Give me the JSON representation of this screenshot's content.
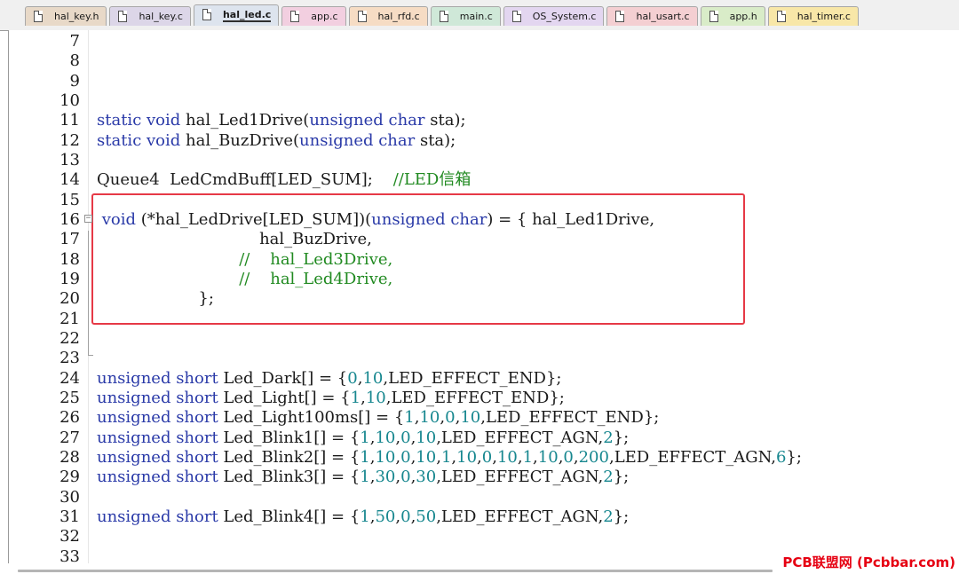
{
  "tabs": [
    {
      "label": "hal_key.h",
      "color": "#e8d9c8",
      "active": false
    },
    {
      "label": "hal_key.c",
      "color": "#dcd6e8",
      "active": false
    },
    {
      "label": "hal_led.c",
      "color": "#dde4ee",
      "active": true
    },
    {
      "label": "app.c",
      "color": "#f2cfe0",
      "active": false
    },
    {
      "label": "hal_rfd.c",
      "color": "#f6dcc4",
      "active": false
    },
    {
      "label": "main.c",
      "color": "#cfe8d8",
      "active": false
    },
    {
      "label": "OS_System.c",
      "color": "#e3d6f0",
      "active": false
    },
    {
      "label": "hal_usart.c",
      "color": "#f4cfd2",
      "active": false
    },
    {
      "label": "app.h",
      "color": "#d9ecc8",
      "active": false
    },
    {
      "label": "hal_timer.c",
      "color": "#f8e7a8",
      "active": false
    }
  ],
  "lines": [
    {
      "n": "7",
      "code": []
    },
    {
      "n": "8",
      "code": []
    },
    {
      "n": "9",
      "code": []
    },
    {
      "n": "10",
      "code": []
    },
    {
      "n": "11",
      "code": [
        [
          "kw",
          "static void"
        ],
        [
          "txt",
          " hal_Led1Drive("
        ],
        [
          "kw",
          "unsigned char"
        ],
        [
          "txt",
          " sta);"
        ]
      ]
    },
    {
      "n": "12",
      "code": [
        [
          "kw",
          "static void"
        ],
        [
          "txt",
          " hal_BuzDrive("
        ],
        [
          "kw",
          "unsigned char"
        ],
        [
          "txt",
          " sta);"
        ]
      ]
    },
    {
      "n": "13",
      "code": []
    },
    {
      "n": "14",
      "code": [
        [
          "txt",
          "Queue4  LedCmdBuff[LED_SUM];    "
        ],
        [
          "cm",
          "//LED信箱"
        ]
      ]
    },
    {
      "n": "15",
      "code": []
    },
    {
      "n": "16",
      "code": [
        [
          "txt",
          " "
        ],
        [
          "kw",
          "void"
        ],
        [
          "txt",
          " (*hal_LedDrive[LED_SUM])("
        ],
        [
          "kw",
          "unsigned char"
        ],
        [
          "txt",
          ") = { hal_Led1Drive,"
        ]
      ],
      "fold": true
    },
    {
      "n": "17",
      "code": [
        [
          "txt",
          "                                hal_BuzDrive,"
        ]
      ]
    },
    {
      "n": "18",
      "code": [
        [
          "cm",
          "                            //    hal_Led3Drive,"
        ]
      ]
    },
    {
      "n": "19",
      "code": [
        [
          "cm",
          "                            //    hal_Led4Drive,"
        ]
      ]
    },
    {
      "n": "20",
      "code": [
        [
          "txt",
          "                    };"
        ]
      ]
    },
    {
      "n": "21",
      "code": []
    },
    {
      "n": "22",
      "code": []
    },
    {
      "n": "23",
      "code": []
    },
    {
      "n": "24",
      "code": [
        [
          "kw",
          "unsigned short"
        ],
        [
          "txt",
          " Led_Dark[] = {"
        ],
        [
          "num",
          "0"
        ],
        [
          "txt",
          ","
        ],
        [
          "num",
          "10"
        ],
        [
          "txt",
          ",LED_EFFECT_END};"
        ]
      ]
    },
    {
      "n": "25",
      "code": [
        [
          "kw",
          "unsigned short"
        ],
        [
          "txt",
          " Led_Light[] = {"
        ],
        [
          "num",
          "1"
        ],
        [
          "txt",
          ","
        ],
        [
          "num",
          "10"
        ],
        [
          "txt",
          ",LED_EFFECT_END};"
        ]
      ]
    },
    {
      "n": "26",
      "code": [
        [
          "kw",
          "unsigned short"
        ],
        [
          "txt",
          " Led_Light100ms[] = {"
        ],
        [
          "num",
          "1"
        ],
        [
          "txt",
          ","
        ],
        [
          "num",
          "10"
        ],
        [
          "txt",
          ","
        ],
        [
          "num",
          "0"
        ],
        [
          "txt",
          ","
        ],
        [
          "num",
          "10"
        ],
        [
          "txt",
          ",LED_EFFECT_END};"
        ]
      ]
    },
    {
      "n": "27",
      "code": [
        [
          "kw",
          "unsigned short"
        ],
        [
          "txt",
          " Led_Blink1[] = {"
        ],
        [
          "num",
          "1"
        ],
        [
          "txt",
          ","
        ],
        [
          "num",
          "10"
        ],
        [
          "txt",
          ","
        ],
        [
          "num",
          "0"
        ],
        [
          "txt",
          ","
        ],
        [
          "num",
          "10"
        ],
        [
          "txt",
          ",LED_EFFECT_AGN,"
        ],
        [
          "num",
          "2"
        ],
        [
          "txt",
          "};"
        ]
      ]
    },
    {
      "n": "28",
      "code": [
        [
          "kw",
          "unsigned short"
        ],
        [
          "txt",
          " Led_Blink2[] = {"
        ],
        [
          "num",
          "1"
        ],
        [
          "txt",
          ","
        ],
        [
          "num",
          "10"
        ],
        [
          "txt",
          ","
        ],
        [
          "num",
          "0"
        ],
        [
          "txt",
          ","
        ],
        [
          "num",
          "10"
        ],
        [
          "txt",
          ","
        ],
        [
          "num",
          "1"
        ],
        [
          "txt",
          ","
        ],
        [
          "num",
          "10"
        ],
        [
          "txt",
          ","
        ],
        [
          "num",
          "0"
        ],
        [
          "txt",
          ","
        ],
        [
          "num",
          "10"
        ],
        [
          "txt",
          ","
        ],
        [
          "num",
          "1"
        ],
        [
          "txt",
          ","
        ],
        [
          "num",
          "10"
        ],
        [
          "txt",
          ","
        ],
        [
          "num",
          "0"
        ],
        [
          "txt",
          ","
        ],
        [
          "num",
          "200"
        ],
        [
          "txt",
          ",LED_EFFECT_AGN,"
        ],
        [
          "num",
          "6"
        ],
        [
          "txt",
          "};"
        ]
      ]
    },
    {
      "n": "29",
      "code": [
        [
          "kw",
          "unsigned short"
        ],
        [
          "txt",
          " Led_Blink3[] = {"
        ],
        [
          "num",
          "1"
        ],
        [
          "txt",
          ","
        ],
        [
          "num",
          "30"
        ],
        [
          "txt",
          ","
        ],
        [
          "num",
          "0"
        ],
        [
          "txt",
          ","
        ],
        [
          "num",
          "30"
        ],
        [
          "txt",
          ",LED_EFFECT_AGN,"
        ],
        [
          "num",
          "2"
        ],
        [
          "txt",
          "};"
        ]
      ]
    },
    {
      "n": "30",
      "code": []
    },
    {
      "n": "31",
      "code": [
        [
          "kw",
          "unsigned short"
        ],
        [
          "txt",
          " Led_Blink4[] = {"
        ],
        [
          "num",
          "1"
        ],
        [
          "txt",
          ","
        ],
        [
          "num",
          "50"
        ],
        [
          "txt",
          ","
        ],
        [
          "num",
          "0"
        ],
        [
          "txt",
          ","
        ],
        [
          "num",
          "50"
        ],
        [
          "txt",
          ",LED_EFFECT_AGN,"
        ],
        [
          "num",
          "2"
        ],
        [
          "txt",
          "};"
        ]
      ]
    },
    {
      "n": "32",
      "code": []
    },
    {
      "n": "33",
      "code": []
    }
  ],
  "fold_marker": "⊟",
  "watermark": "PCB联盟网 (Pcbbar.com)"
}
